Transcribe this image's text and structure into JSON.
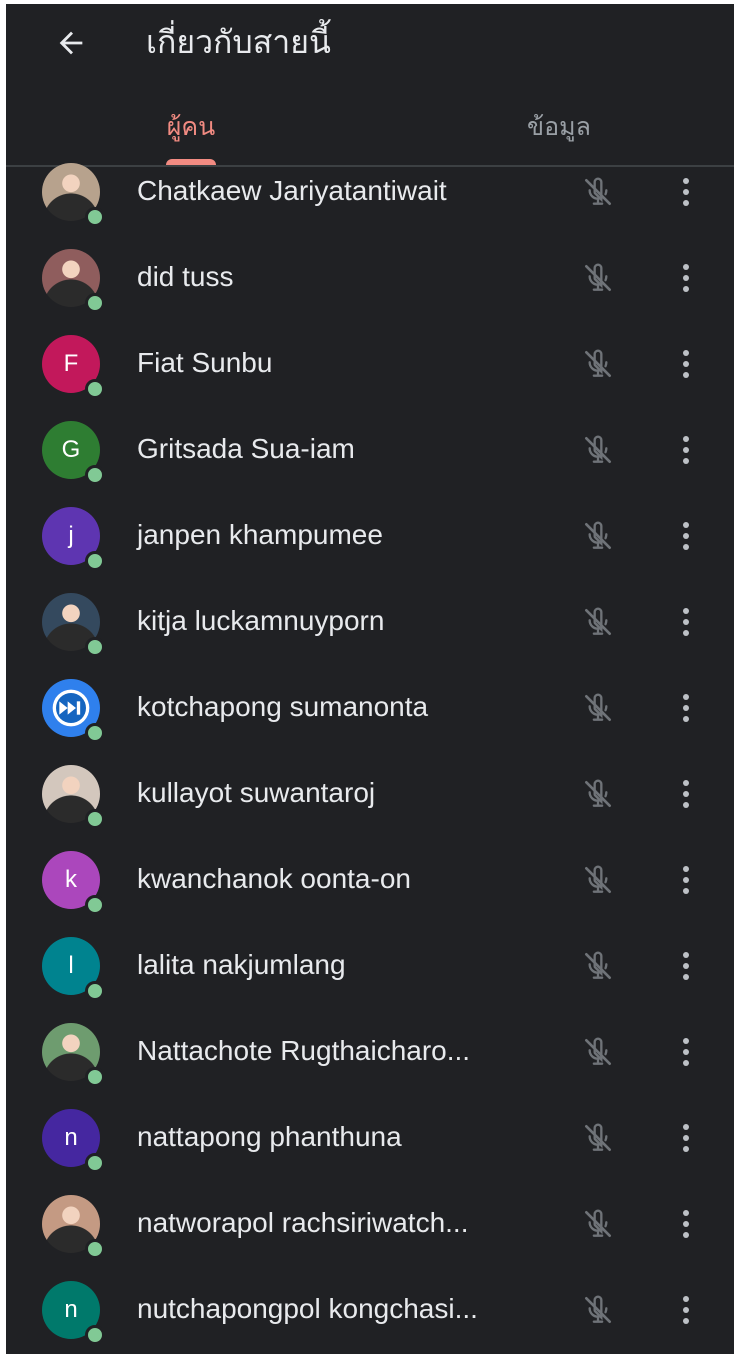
{
  "header": {
    "title": "เกี่ยวกับสายนี้"
  },
  "tabs": [
    {
      "label": "ผู้คน",
      "active": true
    },
    {
      "label": "ข้อมูล",
      "active": false
    }
  ],
  "colors": {
    "background": "#202124",
    "text": "#e8eaed",
    "active_tab": "#f28b82",
    "inactive_tab": "#9aa0a6",
    "presence": "#81c995"
  },
  "participants": [
    {
      "name": "Chatkaew Jariyatantiwait",
      "avatar": "photo",
      "avatar_color": "#b7a28d"
    },
    {
      "name": "did tuss",
      "avatar": "photo",
      "avatar_color": "#8f5d5d"
    },
    {
      "name": "Fiat Sunbu",
      "avatar": "F",
      "avatar_color": "#c2185b"
    },
    {
      "name": "Gritsada Sua-iam",
      "avatar": "G",
      "avatar_color": "#2e7d32"
    },
    {
      "name": "janpen khampumee",
      "avatar": "j",
      "avatar_color": "#5e35b1"
    },
    {
      "name": "kitja luckamnuyporn",
      "avatar": "photo",
      "avatar_color": "#34495e"
    },
    {
      "name": "kotchapong sumanonta",
      "avatar": "fast-forward-icon",
      "avatar_color": "#2f80ed"
    },
    {
      "name": "kullayot suwantaroj",
      "avatar": "photo",
      "avatar_color": "#d3c7bd"
    },
    {
      "name": "kwanchanok oonta-on",
      "avatar": "k",
      "avatar_color": "#ab47bc"
    },
    {
      "name": "lalita nakjumlang",
      "avatar": "l",
      "avatar_color": "#00838f"
    },
    {
      "name": "Nattachote Rugthaicharo...",
      "avatar": "photo",
      "avatar_color": "#6e9c6f"
    },
    {
      "name": "nattapong phanthuna",
      "avatar": "n",
      "avatar_color": "#4527a0"
    },
    {
      "name": "natworapol rachsiriwatch...",
      "avatar": "photo",
      "avatar_color": "#c49a83"
    },
    {
      "name": "nutchapongpol kongchasi...",
      "avatar": "n",
      "avatar_color": "#00796b"
    }
  ]
}
